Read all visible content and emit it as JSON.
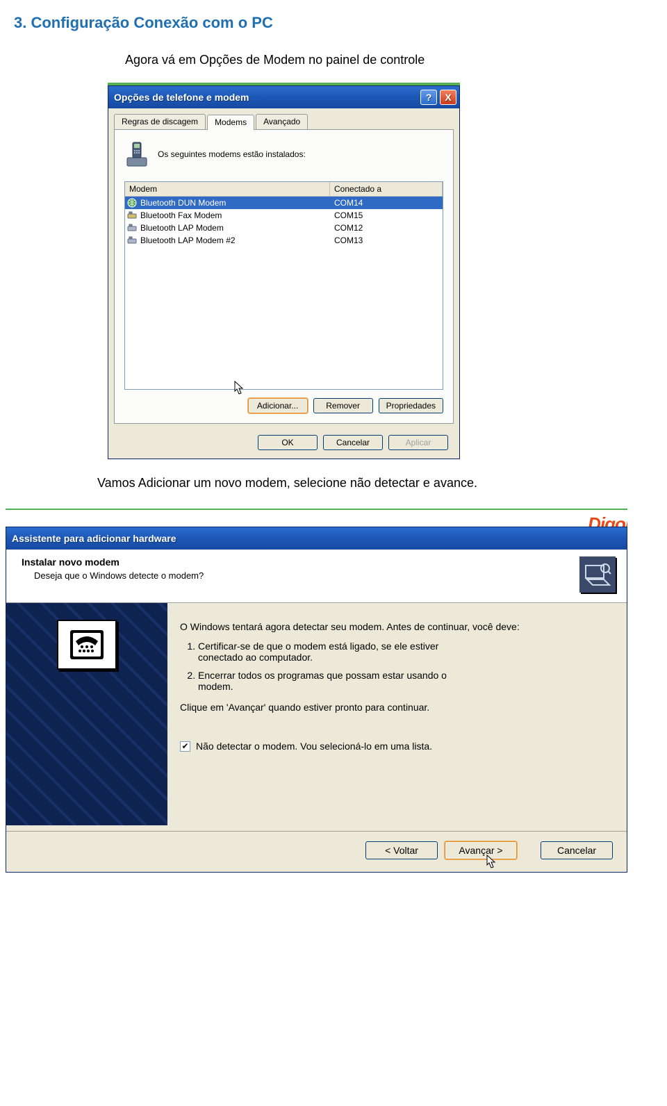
{
  "heading": "3. Configuração Conexão com o PC",
  "intro": "Agora vá em Opções de Modem no painel de controle",
  "intro2": "Vamos Adicionar um novo modem, selecione não detectar e avance.",
  "dlg1": {
    "title": "Opções de telefone e modem",
    "help": "?",
    "close": "X",
    "tabs": {
      "t1": "Regras de discagem",
      "t2": "Modems",
      "t3": "Avançado"
    },
    "caption": "Os seguintes modems estão instalados:",
    "cols": {
      "c1": "Modem",
      "c2": "Conectado a"
    },
    "rows": [
      {
        "name": "Bluetooth DUN Modem",
        "port": "COM14",
        "selected": true,
        "icon": "globe"
      },
      {
        "name": "Bluetooth Fax Modem",
        "port": "COM15",
        "selected": false,
        "icon": "modem-y"
      },
      {
        "name": "Bluetooth LAP Modem",
        "port": "COM12",
        "selected": false,
        "icon": "modem"
      },
      {
        "name": "Bluetooth LAP Modem #2",
        "port": "COM13",
        "selected": false,
        "icon": "modem"
      }
    ],
    "buttons": {
      "add": "Adicionar...",
      "remove": "Remover",
      "props": "Propriedades",
      "ok": "OK",
      "cancel": "Cancelar",
      "apply": "Aplicar"
    }
  },
  "brand_fragment": "Digor",
  "dlg2": {
    "title": "Assistente para adicionar hardware",
    "header_title": "Instalar novo modem",
    "header_sub": "Deseja que o Windows detecte o modem?",
    "p_intro": "O Windows tentará agora detectar seu modem. Antes de continuar, você deve:",
    "li1": "Certificar-se de que o modem está ligado, se ele estiver conectado ao computador.",
    "li2": "Encerrar todos os programas que possam estar usando o modem.",
    "cont": "Clique em 'Avançar' quando estiver pronto para continuar.",
    "chk_label": "Não detectar o modem. Vou selecioná-lo em uma lista.",
    "chk_checked": true,
    "buttons": {
      "back": "< Voltar",
      "next": "Avançar >",
      "cancel": "Cancelar"
    }
  }
}
